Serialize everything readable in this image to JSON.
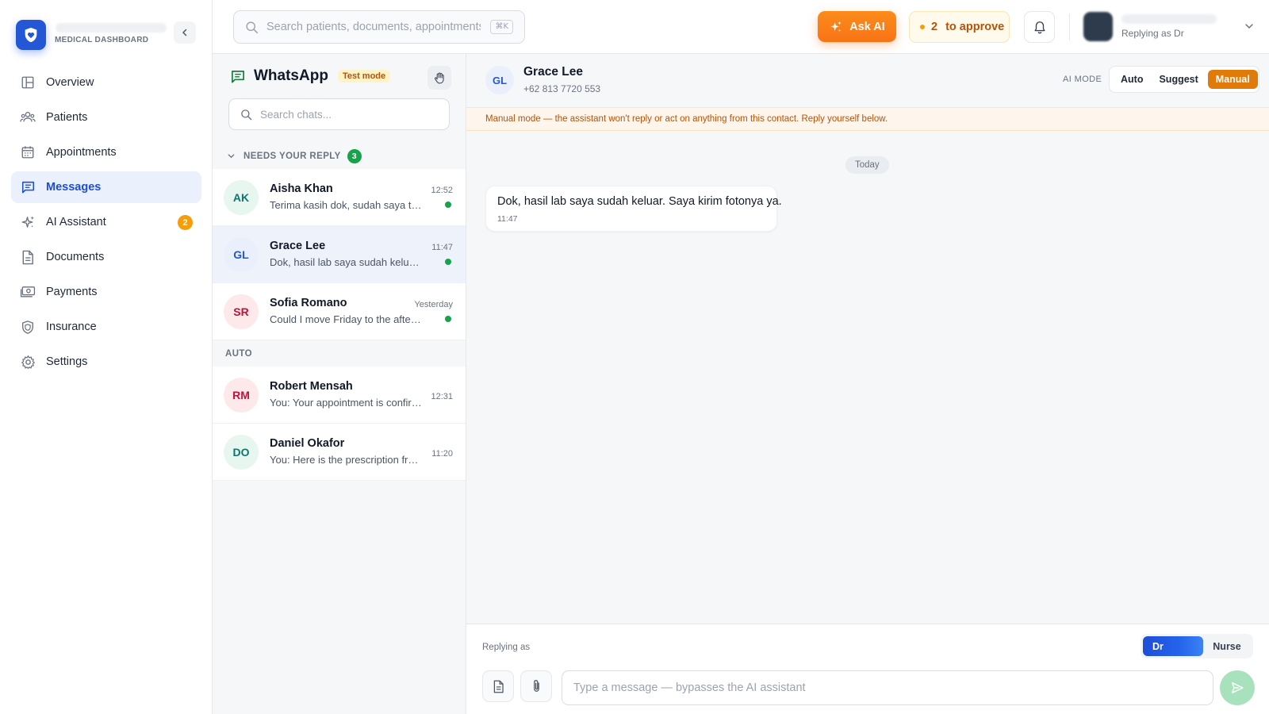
{
  "brand": {
    "subtitle": "MEDICAL DASHBOARD"
  },
  "colors": {
    "primary": "#2457d6",
    "accent_orange": "#f97316",
    "unread_green": "#16a34a",
    "warning": "#b45309"
  },
  "nav": {
    "items": [
      {
        "label": "Overview",
        "icon": "layout-icon",
        "active": false
      },
      {
        "label": "Patients",
        "icon": "users-icon",
        "active": false
      },
      {
        "label": "Appointments",
        "icon": "calendar-icon",
        "active": false
      },
      {
        "label": "Messages",
        "icon": "message-icon",
        "active": true
      },
      {
        "label": "AI Assistant",
        "icon": "sparkles-icon",
        "active": false,
        "badge": "2"
      },
      {
        "label": "Documents",
        "icon": "document-icon",
        "active": false
      },
      {
        "label": "Payments",
        "icon": "cash-icon",
        "active": false
      },
      {
        "label": "Insurance",
        "icon": "shield-icon",
        "active": false
      },
      {
        "label": "Settings",
        "icon": "gear-icon",
        "active": false
      }
    ]
  },
  "topbar": {
    "search_placeholder": "Search patients, documents, appointments...",
    "shortcut": "⌘K",
    "ask_ai_label": "Ask AI",
    "approve_count": "2",
    "approve_label": "to approve",
    "profile_role": "Replying as Dr"
  },
  "chat_list": {
    "title": "WhatsApp",
    "test_badge": "Test mode",
    "search_placeholder": "Search chats...",
    "sections": {
      "needs_reply": {
        "label": "NEEDS YOUR REPLY",
        "count": "3"
      },
      "auto": {
        "label": "AUTO"
      }
    },
    "needs_reply": [
      {
        "initials": "AK",
        "name": "Aisha Khan",
        "preview": "Terima kasih dok, sudah saya transfer.",
        "time": "12:52",
        "unread": true
      },
      {
        "initials": "GL",
        "name": "Grace Lee",
        "preview": "Dok, hasil lab saya sudah keluar. Saya kirim fotonya ya.",
        "time": "11:47",
        "unread": true
      },
      {
        "initials": "SR",
        "name": "Sofia Romano",
        "preview": "Could I move Friday to the afternoon?",
        "time": "Yesterday",
        "unread": true
      }
    ],
    "auto": [
      {
        "initials": "RM",
        "name": "Robert Mensah",
        "preview": "You: Your appointment is confirmed.",
        "time": "12:31"
      },
      {
        "initials": "DO",
        "name": "Daniel Okafor",
        "preview": "You: Here is the prescription from today.",
        "time": "11:20"
      }
    ]
  },
  "conversation": {
    "initials": "GL",
    "name": "Grace Lee",
    "phone": "+62 813 7720 553",
    "ai_mode_label": "AI MODE",
    "modes": [
      "Auto",
      "Suggest",
      "Manual"
    ],
    "active_mode": "Manual",
    "banner": "Manual mode — the assistant won't reply or act on anything from this contact. Reply yourself below.",
    "day_label": "Today",
    "messages": [
      {
        "text": "Dok, hasil lab saya sudah keluar. Saya kirim fotonya ya.",
        "time": "11:47"
      }
    ]
  },
  "composer": {
    "replying_as_label": "Replying as",
    "roles": [
      "Dr",
      "Nurse"
    ],
    "active_role": "Dr",
    "placeholder": "Type a message — bypasses the AI assistant"
  }
}
